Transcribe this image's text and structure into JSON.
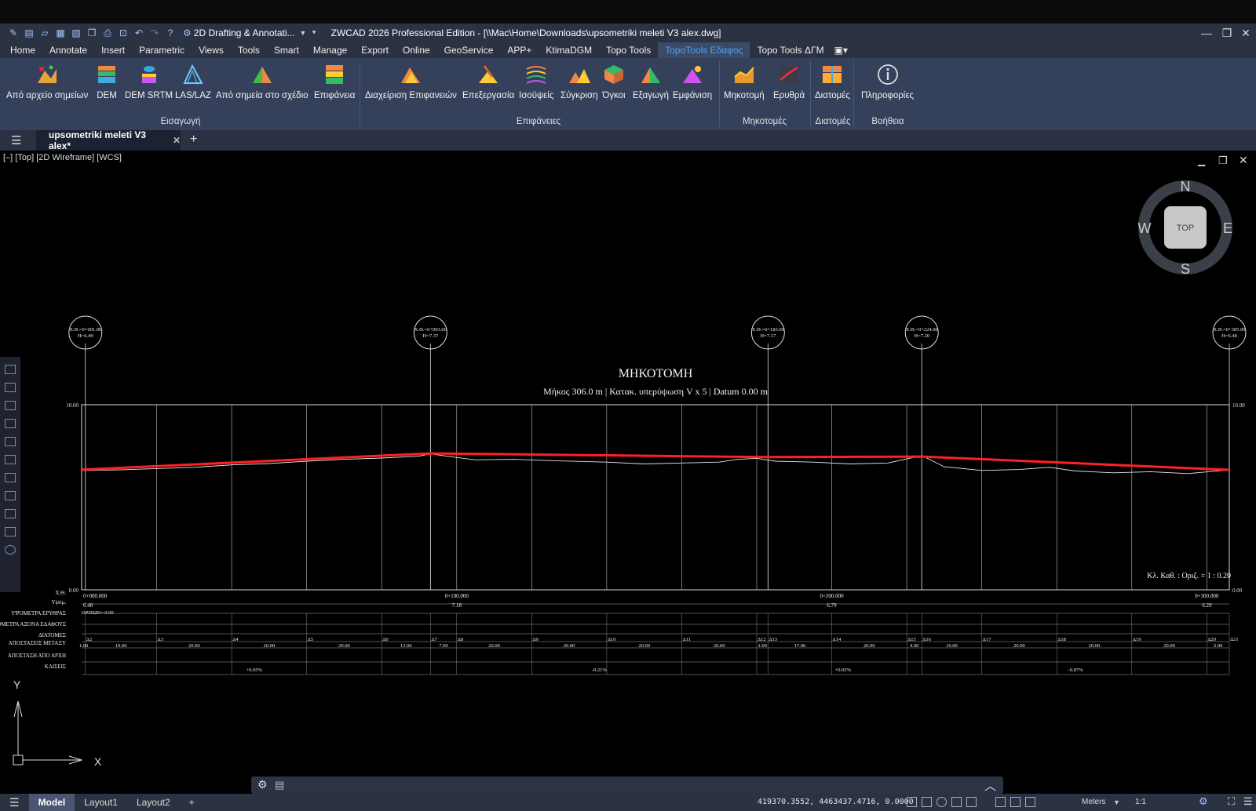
{
  "app": {
    "title": "ZWCAD 2026 Professional Edition - [\\\\Mac\\Home\\Downloads\\upsometriki meleti V3 alex.dwg]",
    "workspace": "2D Drafting & Annotati...",
    "accent_color": "#4aa3ff",
    "chrome_color": "#2b3242",
    "ribbon_color": "#35405a"
  },
  "menu": [
    "Home",
    "Annotate",
    "Insert",
    "Parametric",
    "Views",
    "Tools",
    "Smart",
    "Manage",
    "Export",
    "Online",
    "GeoService",
    "APP+",
    "KtimaDGM",
    "Topo Tools",
    "TopoTools Εδαφος",
    "Topo Tools ΔΓΜ"
  ],
  "menu_active": "TopoTools Εδαφος",
  "ribbon": {
    "buttons": [
      "Από αρχείο σημείων",
      "DEM",
      "DEM SRTM",
      "LAS/LAZ",
      "Από σημεία στο σχέδιο",
      "Επιφάνεια",
      "Διαχείριση Επιφανειών",
      "Επεξεργασία",
      "Ισοϋψείς",
      "Σύγκριση",
      "Όγκοι",
      "Εξαγωγή",
      "Εμφάνιση",
      "Μηκοτομή",
      "Ερυθρά",
      "Διατομές",
      "Πληροφορίες"
    ],
    "panels": [
      "Εισαγωγή",
      "Επιφάνειες",
      "Μηκοτομές",
      "Διατομές",
      "Βοήθεια"
    ]
  },
  "tabs": {
    "document": "upsometriki meleti V3 alex*",
    "add": "+"
  },
  "viewport": {
    "label": "[–] [Top] [2D Wireframe] [WCS]",
    "viewcube": {
      "top": "TOP",
      "north": "N",
      "south": "S",
      "east": "E",
      "west": "W"
    },
    "ucs": {
      "x": "X",
      "y": "Y"
    }
  },
  "drawing": {
    "title": "ΜΗΚΟΤΟΜΗ",
    "subtitle": "Μήκος 306.0 m  |  Κατακ. υπερύψωση V x 5  |  Datum 0.00 m",
    "scale_note": "Κλ. Καθ. : Οριζ. = 1 : 0.20",
    "markers": [
      {
        "label": "Χ.Θ.=0+001.00",
        "h": "Η=6.49"
      },
      {
        "label": "Χ.Θ.=0+093.00",
        "h": "Η=7.37"
      },
      {
        "label": "Χ.Θ.=0+183.00",
        "h": "Η=7.17"
      },
      {
        "label": "Χ.Θ.=0+224.00",
        "h": "Η=7.20"
      },
      {
        "label": "Χ.Θ.=0+305.99",
        "h": "Η=6.48"
      }
    ],
    "y_top_label": "10.00",
    "y_bottom_label": "0.00",
    "station_labels": [
      "0+000.000",
      "0+100.000",
      "0+200.000",
      "0+300.000"
    ],
    "elev_labels": [
      "6.48",
      "7.18",
      "6.79",
      "6.29"
    ],
    "datum_label": "ΟΡΙΖΩΝ= 0.00",
    "row_labels": [
      "Χ.Θ.",
      "Υψόμ.",
      "ΥΨΟΜΕΤΡΑ ΕΡΥΘΡΑΣ",
      "ΥΨΟΜΕΤΡΑ ΑΞΟΝΑ ΕΔΑΦΟΥΣ",
      "ΔΙΑΤΟΜΕΣ",
      "ΑΠΟΣΤΑΣΕΙΣ ΜΕΤΑΞΥ",
      "ΑΠΟΣΤΑΣΗ ΑΠΟ ΑΡΧΗ",
      "ΚΛΙΣΕΙΣ"
    ],
    "sections": [
      "Δ2",
      "Δ3",
      "Δ4",
      "Δ5",
      "Δ6",
      "Δ7",
      "Δ8",
      "Δ9",
      "Δ10",
      "Δ11",
      "Δ12",
      "Δ13",
      "Δ14",
      "Δ15",
      "Δ16",
      "Δ17",
      "Δ18",
      "Δ19",
      "Δ20",
      "Δ21"
    ],
    "partial_dists": [
      "1.00",
      "19.00",
      "20.00",
      "20.00",
      "20.00",
      "13.00",
      "7.00",
      "20.00",
      "20.00",
      "20.00",
      "20.00",
      "1.00",
      "17.00",
      "20.00",
      "4.00",
      "16.00",
      "20.00",
      "20.00",
      "20.00",
      "5.99"
    ],
    "slopes": [
      "+0.95%",
      "-0.21%",
      "+0.05%",
      "-0.87%"
    ],
    "red_color": "#ff2020",
    "red_line": [
      [
        0,
        6.49
      ],
      [
        93,
        7.37
      ],
      [
        183,
        7.17
      ],
      [
        224,
        7.2
      ],
      [
        306,
        6.48
      ]
    ],
    "ground_line": [
      [
        0,
        6.45
      ],
      [
        10,
        6.48
      ],
      [
        20,
        6.55
      ],
      [
        30,
        6.62
      ],
      [
        40,
        6.75
      ],
      [
        50,
        6.82
      ],
      [
        60,
        6.95
      ],
      [
        70,
        7.05
      ],
      [
        80,
        7.12
      ],
      [
        90,
        7.22
      ],
      [
        93,
        7.35
      ],
      [
        98,
        7.2
      ],
      [
        105,
        7.02
      ],
      [
        115,
        7.05
      ],
      [
        125,
        6.98
      ],
      [
        140,
        6.9
      ],
      [
        150,
        6.8
      ],
      [
        160,
        6.85
      ],
      [
        170,
        6.9
      ],
      [
        175,
        7.05
      ],
      [
        180,
        7.1
      ],
      [
        185,
        6.95
      ],
      [
        195,
        6.9
      ],
      [
        205,
        6.8
      ],
      [
        215,
        6.85
      ],
      [
        224,
        7.25
      ],
      [
        230,
        6.65
      ],
      [
        240,
        6.45
      ],
      [
        250,
        6.5
      ],
      [
        258,
        6.62
      ],
      [
        265,
        6.42
      ],
      [
        275,
        6.32
      ],
      [
        285,
        6.38
      ],
      [
        295,
        6.28
      ],
      [
        306,
        6.48
      ]
    ]
  },
  "layout_tabs": [
    "Model",
    "Layout1",
    "Layout2",
    "+"
  ],
  "status": {
    "coords": "419370.3552, 4463437.4716, 0.0000",
    "units": "Meters",
    "scale": "1:1"
  }
}
